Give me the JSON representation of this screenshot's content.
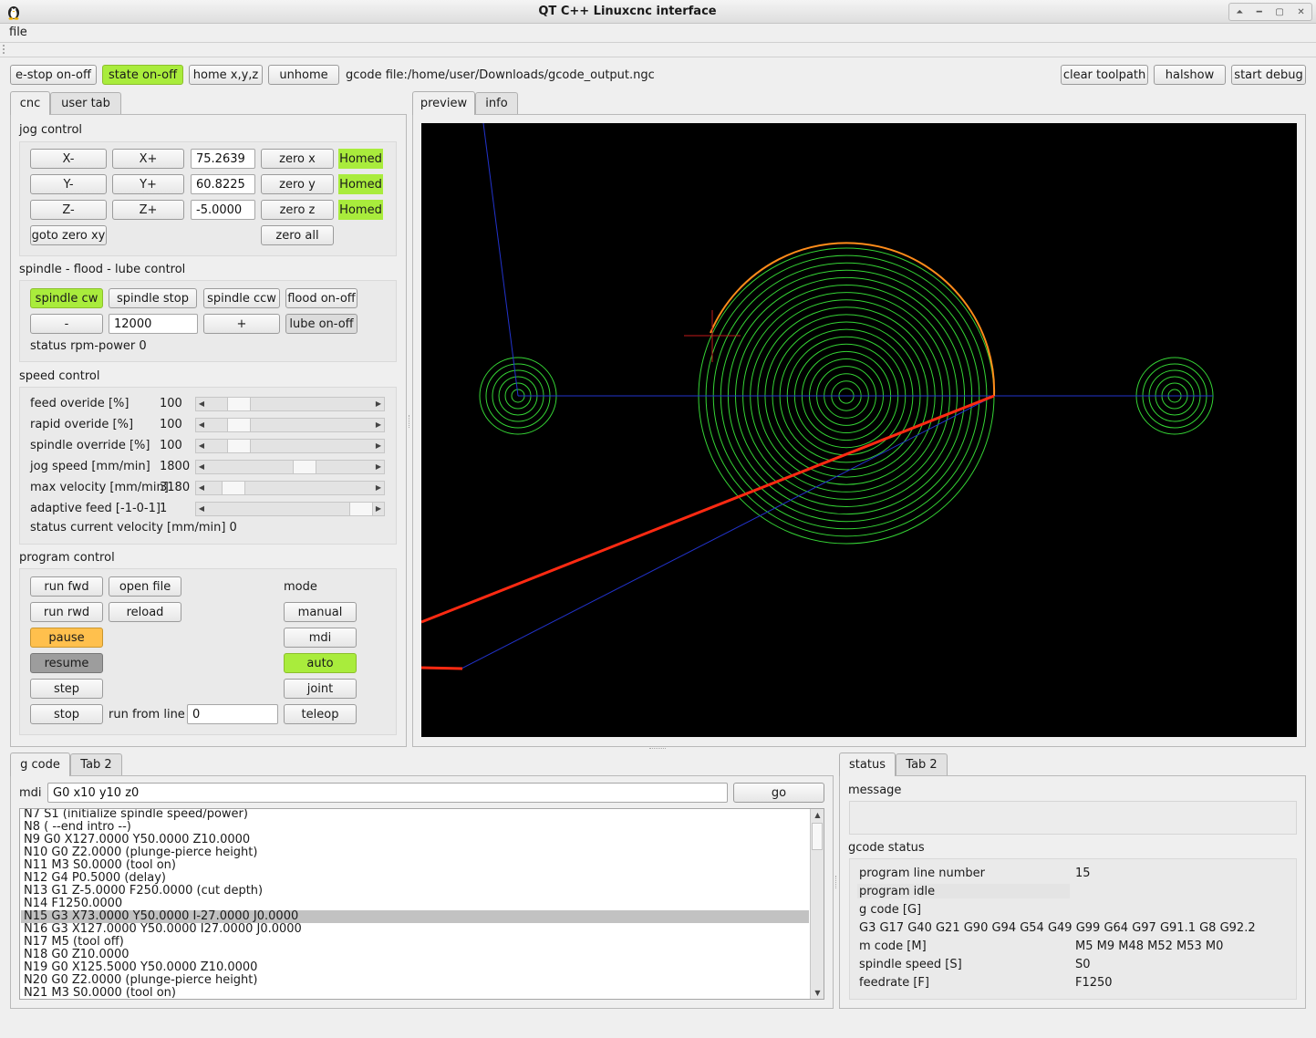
{
  "window": {
    "title": "QT C++ Linuxcnc interface"
  },
  "menu": {
    "file": "file"
  },
  "toolbar": {
    "estop": "e-stop on-off",
    "state": "state on-off",
    "home": "home x,y,z",
    "unhome": "unhome",
    "gcode_file": "gcode file:/home/user/Downloads/gcode_output.ngc",
    "clear_toolpath": "clear toolpath",
    "halshow": "halshow",
    "start_debug": "start debug"
  },
  "left_tabs": [
    "cnc",
    "user tab"
  ],
  "jog": {
    "title": "jog control",
    "x_minus": "X-",
    "x_plus": "X+",
    "x_value": "75.2639",
    "zero_x": "zero x",
    "x_status": "Homed",
    "y_minus": "Y-",
    "y_plus": "Y+",
    "y_value": "60.8225",
    "zero_y": "zero y",
    "y_status": "Homed",
    "z_minus": "Z-",
    "z_plus": "Z+",
    "z_value": "-5.0000",
    "zero_z": "zero z",
    "z_status": "Homed",
    "goto_zero": "goto zero xy",
    "zero_all": "zero all"
  },
  "spindle": {
    "title": "spindle - flood - lube control",
    "cw": "spindle cw",
    "stop": "spindle stop",
    "ccw": "spindle ccw",
    "flood": "flood on-off",
    "minus": "-",
    "rpm": "12000",
    "plus": "+",
    "lube": "lube on-off",
    "status": "status rpm-power 0"
  },
  "speed": {
    "title": "speed control",
    "rows": [
      {
        "label": "feed overide [%]",
        "value": "100",
        "level": 0.14
      },
      {
        "label": "rapid overide [%]",
        "value": "100",
        "level": 0.14
      },
      {
        "label": "spindle override [%]",
        "value": "100",
        "level": 0.14
      },
      {
        "label": "jog speed [mm/min]",
        "value": "1800",
        "level": 0.6
      },
      {
        "label": "max velocity [mm/min]",
        "value": "3180",
        "level": 0.1
      },
      {
        "label": "adaptive feed [-1-0-1]",
        "value": "1",
        "level": 1.0
      }
    ],
    "status": "status current velocity [mm/min] 0"
  },
  "program": {
    "title": "program control",
    "run_fwd": "run fwd",
    "open_file": "open file",
    "mode": "mode",
    "run_rwd": "run rwd",
    "reload": "reload",
    "manual": "manual",
    "pause": "pause",
    "mdi": "mdi",
    "resume": "resume",
    "auto": "auto",
    "step": "step",
    "joint": "joint",
    "stop": "stop",
    "run_from_line": "run from line",
    "line_value": "0",
    "teleop": "teleop"
  },
  "preview_tabs": [
    "preview",
    "info"
  ],
  "bottom_left_tabs": [
    "g code",
    "Tab 2"
  ],
  "mdi": {
    "label": "mdi",
    "value": "G0 x10 y10 z0",
    "go": "go"
  },
  "gcode_lines": [
    "N7 S1 (initialize spindle speed/power)",
    "N8  ( --end intro --)",
    "N9 G0 X127.0000 Y50.0000 Z10.0000",
    "N10 G0 Z2.0000 (plunge-pierce height)",
    "N11 M3 S0.0000 (tool on)",
    "N12 G4 P0.5000 (delay)",
    "N13 G1 Z-5.0000 F250.0000 (cut depth)",
    "N14 F1250.0000",
    "N15 G3 X73.0000 Y50.0000 I-27.0000 J0.0000",
    "N16 G3 X127.0000 Y50.0000 I27.0000 J0.0000",
    "N17 M5 (tool off)",
    "N18 G0 Z10.0000",
    "N19 G0 X125.5000 Y50.0000 Z10.0000",
    "N20 G0 Z2.0000 (plunge-pierce height)",
    "N21 M3 S0.0000 (tool on)"
  ],
  "gcode_selected": 8,
  "bottom_right_tabs": [
    "status",
    "Tab 2"
  ],
  "status": {
    "message_label": "message",
    "gcode_status_label": "gcode status",
    "program_line_label": "program line number",
    "program_line_value": "15",
    "program_idle": "program idle",
    "gcode_label": "g code [G]",
    "gcode_value": "G3 G17 G40 G21 G90 G94 G54 G49 G99 G64 G97 G91.1 G8 G92.2",
    "mcode_label": "m code [M]",
    "mcode_value": "M5 M9 M48 M52 M53 M0",
    "spindle_label": "spindle speed [S]",
    "spindle_value": "S0",
    "feed_label": "feedrate [F]",
    "feed_value": "F1250"
  },
  "colors": {
    "active_green": "#a9ec3c",
    "pause_orange": "#ffc04d",
    "toolpath_green": "#35d435",
    "rapid_blue": "#2233cc",
    "feed_red": "#ff2a12"
  }
}
